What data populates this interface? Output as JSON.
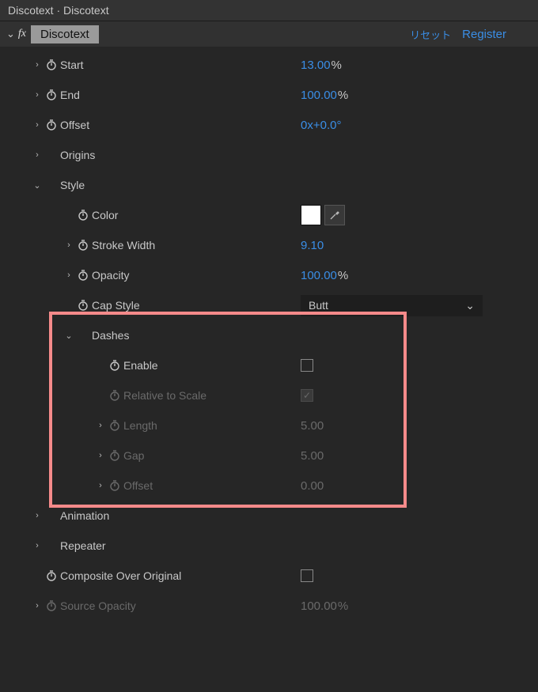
{
  "panel_title": "Discotext · Discotext",
  "effect": {
    "name": "Discotext",
    "reset": "リセット",
    "register": "Register"
  },
  "props": {
    "start": {
      "label": "Start",
      "value": "13.00",
      "unit": "%"
    },
    "end": {
      "label": "End",
      "value": "100.00",
      "unit": "%"
    },
    "offset": {
      "label": "Offset",
      "value": "0",
      "unit": "x+0.0°"
    },
    "origins": {
      "label": "Origins"
    },
    "style": {
      "label": "Style",
      "color": {
        "label": "Color"
      },
      "stroke_width": {
        "label": "Stroke Width",
        "value": "9.10"
      },
      "opacity": {
        "label": "Opacity",
        "value": "100.00",
        "unit": "%"
      },
      "cap_style": {
        "label": "Cap Style",
        "value": "Butt"
      },
      "dashes": {
        "label": "Dashes",
        "enable": {
          "label": "Enable"
        },
        "relative": {
          "label": "Relative to Scale"
        },
        "length": {
          "label": "Length",
          "value": "5.00"
        },
        "gap": {
          "label": "Gap",
          "value": "5.00"
        },
        "offset": {
          "label": "Offset",
          "value": "0.00"
        }
      }
    },
    "animation": {
      "label": "Animation"
    },
    "repeater": {
      "label": "Repeater"
    },
    "composite": {
      "label": "Composite Over Original"
    },
    "source_opacity": {
      "label": "Source Opacity",
      "value": "100.00",
      "unit": "%"
    }
  }
}
